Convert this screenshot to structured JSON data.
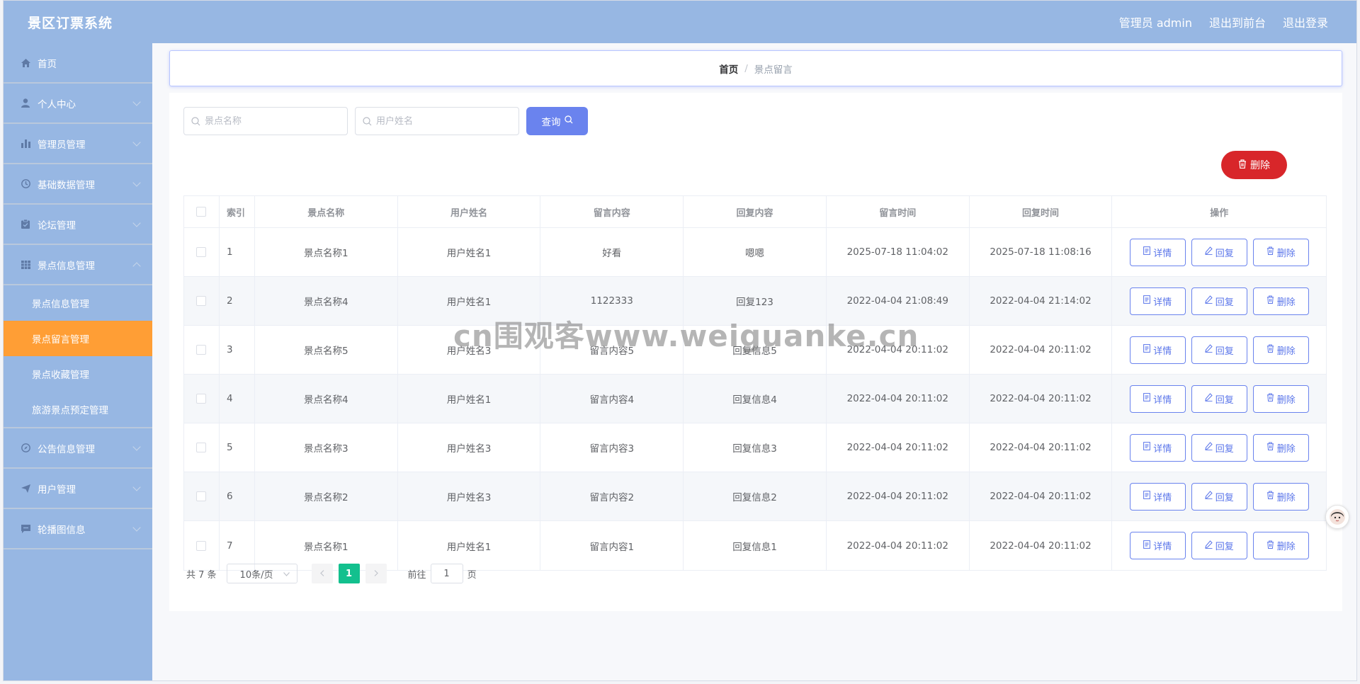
{
  "header": {
    "brand": "景区订票系统",
    "admin_label": "管理员 admin",
    "back_to_front": "退出到前台",
    "logout": "退出登录"
  },
  "sidebar": {
    "items": [
      {
        "label": "首页",
        "icon": "home-icon"
      },
      {
        "label": "个人中心",
        "icon": "user-icon"
      },
      {
        "label": "管理员管理",
        "icon": "chart-icon"
      },
      {
        "label": "基础数据管理",
        "icon": "clock-icon"
      },
      {
        "label": "论坛管理",
        "icon": "clipboard-icon"
      },
      {
        "label": "景点信息管理",
        "icon": "grid-icon"
      }
    ],
    "submenu": [
      {
        "label": "景点信息管理"
      },
      {
        "label": "景点留言管理"
      },
      {
        "label": "景点收藏管理"
      },
      {
        "label": "旅游景点预定管理"
      }
    ],
    "items_after": [
      {
        "label": "公告信息管理",
        "icon": "compass-icon"
      },
      {
        "label": "用户管理",
        "icon": "send-icon"
      },
      {
        "label": "轮播图信息",
        "icon": "message-icon"
      }
    ]
  },
  "breadcrumb": {
    "home": "首页",
    "separator": "/",
    "current": "景点留言"
  },
  "search": {
    "spot_placeholder": "景点名称",
    "user_placeholder": "用户姓名",
    "query_label": "查询"
  },
  "delete_label": "删除",
  "table": {
    "headers": {
      "index": "索引",
      "spot": "景点名称",
      "user": "用户姓名",
      "content": "留言内容",
      "reply": "回复内容",
      "msg_time": "留言时间",
      "reply_time": "回复时间",
      "ops": "操作"
    },
    "ops": {
      "detail": "详情",
      "reply": "回复",
      "delete": "删除"
    },
    "rows": [
      {
        "index": "1",
        "spot": "景点名称1",
        "user": "用户姓名1",
        "content": "好看",
        "reply": "嗯嗯",
        "msg_time": "2025-07-18 11:04:02",
        "reply_time": "2025-07-18 11:08:16"
      },
      {
        "index": "2",
        "spot": "景点名称4",
        "user": "用户姓名1",
        "content": "1122333",
        "reply": "回复123",
        "msg_time": "2022-04-04 21:08:49",
        "reply_time": "2022-04-04 21:14:02"
      },
      {
        "index": "3",
        "spot": "景点名称5",
        "user": "用户姓名3",
        "content": "留言内容5",
        "reply": "回复信息5",
        "msg_time": "2022-04-04 20:11:02",
        "reply_time": "2022-04-04 20:11:02"
      },
      {
        "index": "4",
        "spot": "景点名称4",
        "user": "用户姓名1",
        "content": "留言内容4",
        "reply": "回复信息4",
        "msg_time": "2022-04-04 20:11:02",
        "reply_time": "2022-04-04 20:11:02"
      },
      {
        "index": "5",
        "spot": "景点名称3",
        "user": "用户姓名3",
        "content": "留言内容3",
        "reply": "回复信息3",
        "msg_time": "2022-04-04 20:11:02",
        "reply_time": "2022-04-04 20:11:02"
      },
      {
        "index": "6",
        "spot": "景点名称2",
        "user": "用户姓名3",
        "content": "留言内容2",
        "reply": "回复信息2",
        "msg_time": "2022-04-04 20:11:02",
        "reply_time": "2022-04-04 20:11:02"
      },
      {
        "index": "7",
        "spot": "景点名称1",
        "user": "用户姓名1",
        "content": "留言内容1",
        "reply": "回复信息1",
        "msg_time": "2022-04-04 20:11:02",
        "reply_time": "2022-04-04 20:11:02"
      }
    ]
  },
  "pagination": {
    "total": "共 7 条",
    "page_size": "10条/页",
    "current_page": "1",
    "goto_label": "前往",
    "goto_value": "1",
    "page_unit": "页"
  },
  "watermark": "cn围观客www.weiguanke.cn",
  "colors": {
    "header_bg": "#97b7e3",
    "active_menu": "#ff9e35",
    "primary": "#6a83ee",
    "danger": "#d8262a",
    "page_active": "#13c08e"
  }
}
